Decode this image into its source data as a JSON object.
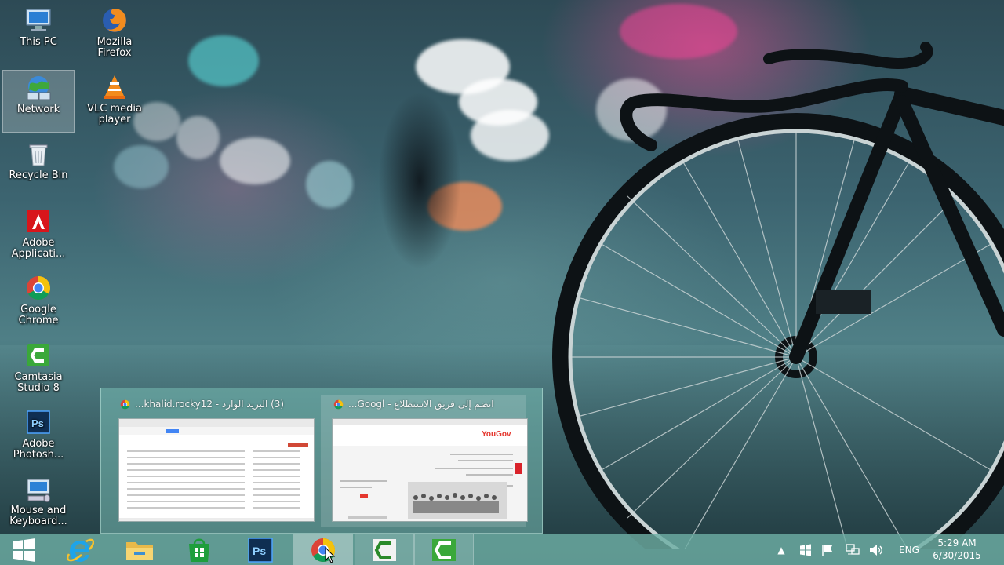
{
  "desktop": {
    "icons": [
      {
        "label": "This PC",
        "icon": "this-pc-icon"
      },
      {
        "label": "Mozilla Firefox",
        "icon": "firefox-icon"
      },
      {
        "label": "Network",
        "icon": "network-icon"
      },
      {
        "label": "VLC media player",
        "icon": "vlc-icon"
      },
      {
        "label": "Recycle Bin",
        "icon": "recycle-bin-icon"
      },
      {
        "label": "Adobe Applicati...",
        "icon": "adobe-icon"
      },
      {
        "label": "Google Chrome",
        "icon": "chrome-icon"
      },
      {
        "label": "Camtasia Studio 8",
        "icon": "camtasia-icon"
      },
      {
        "label": "Adobe Photosh...",
        "icon": "photoshop-icon"
      },
      {
        "label": "Mouse and Keyboard...",
        "icon": "mouse-keyboard-icon"
      }
    ]
  },
  "preview": {
    "windows": [
      {
        "title": "(3) البريد الوارد - khalid.rocky12...",
        "icon": "chrome-icon"
      },
      {
        "title": "انضم إلى فريق الاستطلاع - Googl...",
        "icon": "chrome-icon",
        "site_logo": "YouGov"
      }
    ]
  },
  "taskbar": {
    "pinned": [
      {
        "icon": "windows-start-icon"
      },
      {
        "icon": "internet-explorer-icon"
      },
      {
        "icon": "file-explorer-icon"
      },
      {
        "icon": "store-icon"
      },
      {
        "icon": "photoshop-icon",
        "label": "Ps"
      },
      {
        "icon": "chrome-icon",
        "state": "active"
      },
      {
        "icon": "camtasia-icon",
        "state": "running"
      },
      {
        "icon": "camtasia-recorder-icon",
        "state": "running"
      }
    ],
    "tray": {
      "language": "ENG",
      "time": "5:29 AM",
      "date": "6/30/2015"
    }
  },
  "colors": {
    "taskbar": "#6eafa5",
    "chrome_red": "#db4437",
    "chrome_yellow": "#f4c20d",
    "chrome_green": "#0f9d58",
    "chrome_blue": "#4285f4",
    "camtasia_green": "#3aa83a"
  }
}
